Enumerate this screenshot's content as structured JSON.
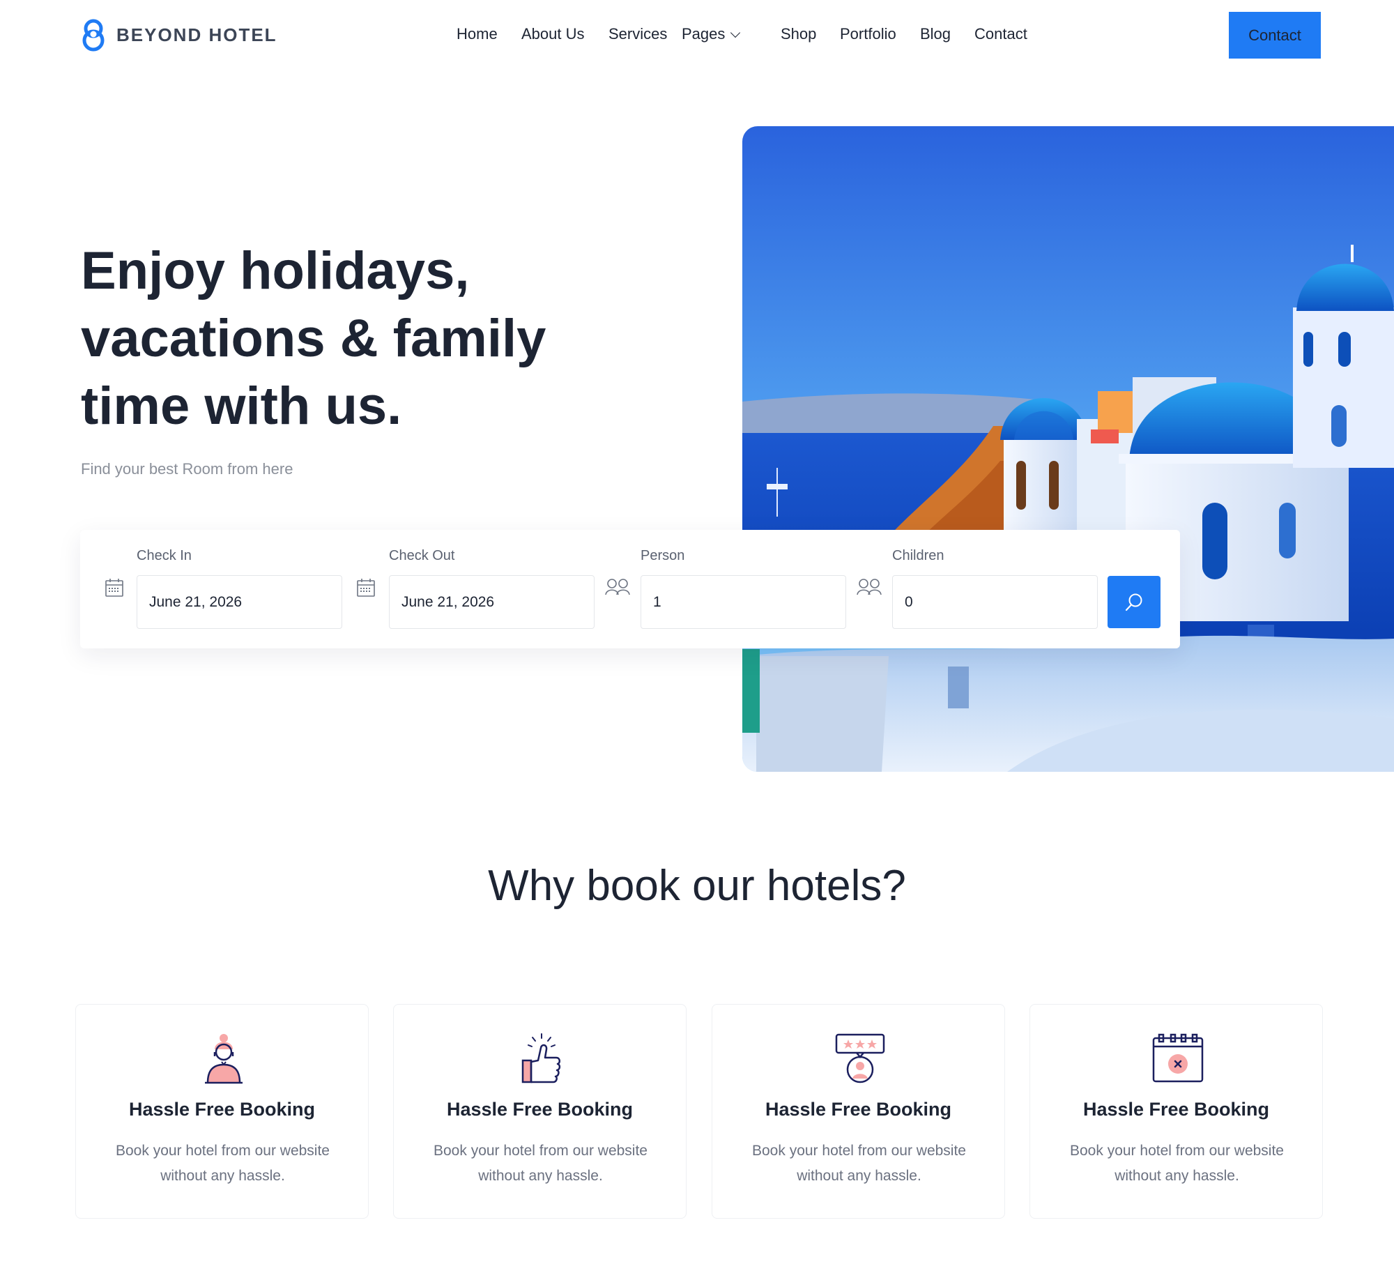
{
  "brand": {
    "name": "BEYOND HOTEL",
    "accent": "#1f7bf4"
  },
  "nav": {
    "items": [
      "Home",
      "About Us",
      "Services",
      "Pages",
      "Shop",
      "Portfolio",
      "Blog",
      "Contact"
    ],
    "cta": "Contact"
  },
  "hero": {
    "title": "Enjoy holidays, vacations & family time with us.",
    "subtitle": "Find your best Room from here",
    "image": "santorini-illustration"
  },
  "booking": {
    "fields": [
      {
        "label": "Check In",
        "value": "June 21, 2026",
        "icon": "calendar-icon"
      },
      {
        "label": "Check Out",
        "value": "June 21, 2026",
        "icon": "calendar-icon"
      },
      {
        "label": "Person",
        "value": "1",
        "icon": "users-icon"
      },
      {
        "label": "Children",
        "value": "0",
        "icon": "users-icon"
      }
    ],
    "search_icon": "search-icon"
  },
  "why": {
    "title": "Why book our hotels?",
    "cards": [
      {
        "icon": "support-agent-icon",
        "title": "Hassle Free Booking",
        "text": "Book your hotel from our website without any hassle."
      },
      {
        "icon": "thumbs-up-icon",
        "title": "Hassle Free Booking",
        "text": "Book your hotel from our website without any hassle."
      },
      {
        "icon": "rating-review-icon",
        "title": "Hassle Free Booking",
        "text": "Book your hotel from our website without any hassle."
      },
      {
        "icon": "calendar-cancel-icon",
        "title": "Hassle Free Booking",
        "text": "Book your hotel from our website without any hassle."
      }
    ]
  }
}
